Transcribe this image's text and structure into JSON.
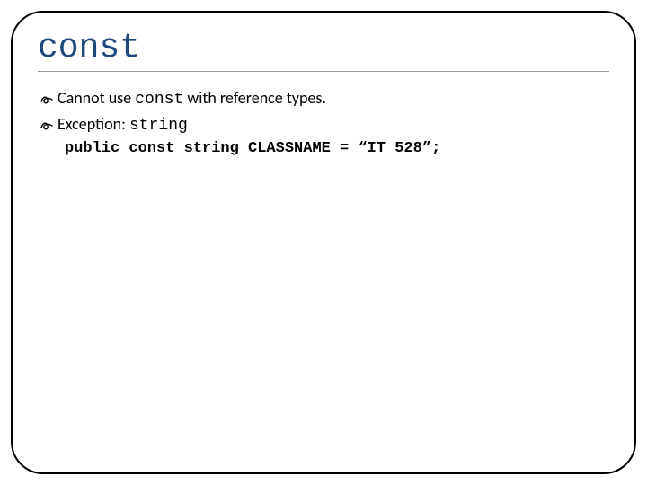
{
  "title": "const",
  "bullets": [
    {
      "pre": "Cannot use ",
      "mono": "const",
      "post": " with reference types."
    },
    {
      "pre": "Exception: ",
      "mono": "string",
      "post": ""
    }
  ],
  "code": "public const string CLASSNAME = “IT 528”;",
  "bullet_glyph": "🖗"
}
